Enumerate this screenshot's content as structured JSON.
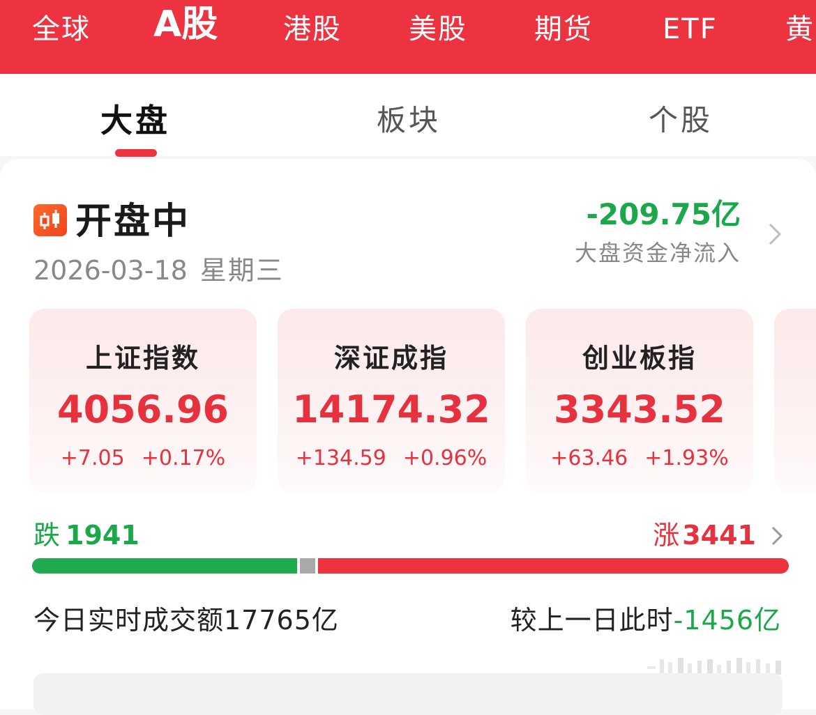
{
  "market_tabs": [
    {
      "label": "全球",
      "active": false
    },
    {
      "label": "A股",
      "active": true
    },
    {
      "label": "港股",
      "active": false
    },
    {
      "label": "美股",
      "active": false
    },
    {
      "label": "期货",
      "active": false
    },
    {
      "label": "ETF",
      "active": false
    },
    {
      "label": "黄",
      "active": false
    }
  ],
  "sub_tabs": [
    {
      "label": "大盘",
      "active": true
    },
    {
      "label": "板块",
      "active": false
    },
    {
      "label": "个股",
      "active": false
    }
  ],
  "status": {
    "icon": "candlestick-icon",
    "title": "开盘中",
    "date": "2026-03-18",
    "weekday": "星期三"
  },
  "fund_flow": {
    "value": "-209.75亿",
    "label": "大盘资金净流入"
  },
  "indices": [
    {
      "name": "上证指数",
      "value": "4056.96",
      "change": "+7.05",
      "change_pct": "+0.17%"
    },
    {
      "name": "深证成指",
      "value": "14174.32",
      "change": "+134.59",
      "change_pct": "+0.96%"
    },
    {
      "name": "创业板指",
      "value": "3343.52",
      "change": "+63.46",
      "change_pct": "+1.93%"
    }
  ],
  "breadth": {
    "fall_label": "跌",
    "fall_count": "1941",
    "rise_label": "涨",
    "rise_count": "3441",
    "fall_fraction": 0.35,
    "flat_fraction": 0.02,
    "rise_fraction": 0.63
  },
  "turnover": {
    "text": "今日实时成交额17765亿",
    "compare_label": "较上一日此时",
    "compare_delta": "-1456亿"
  },
  "colors": {
    "brand_red": "#ee3340",
    "up_red": "#e6313f",
    "down_green": "#1aa84a"
  }
}
